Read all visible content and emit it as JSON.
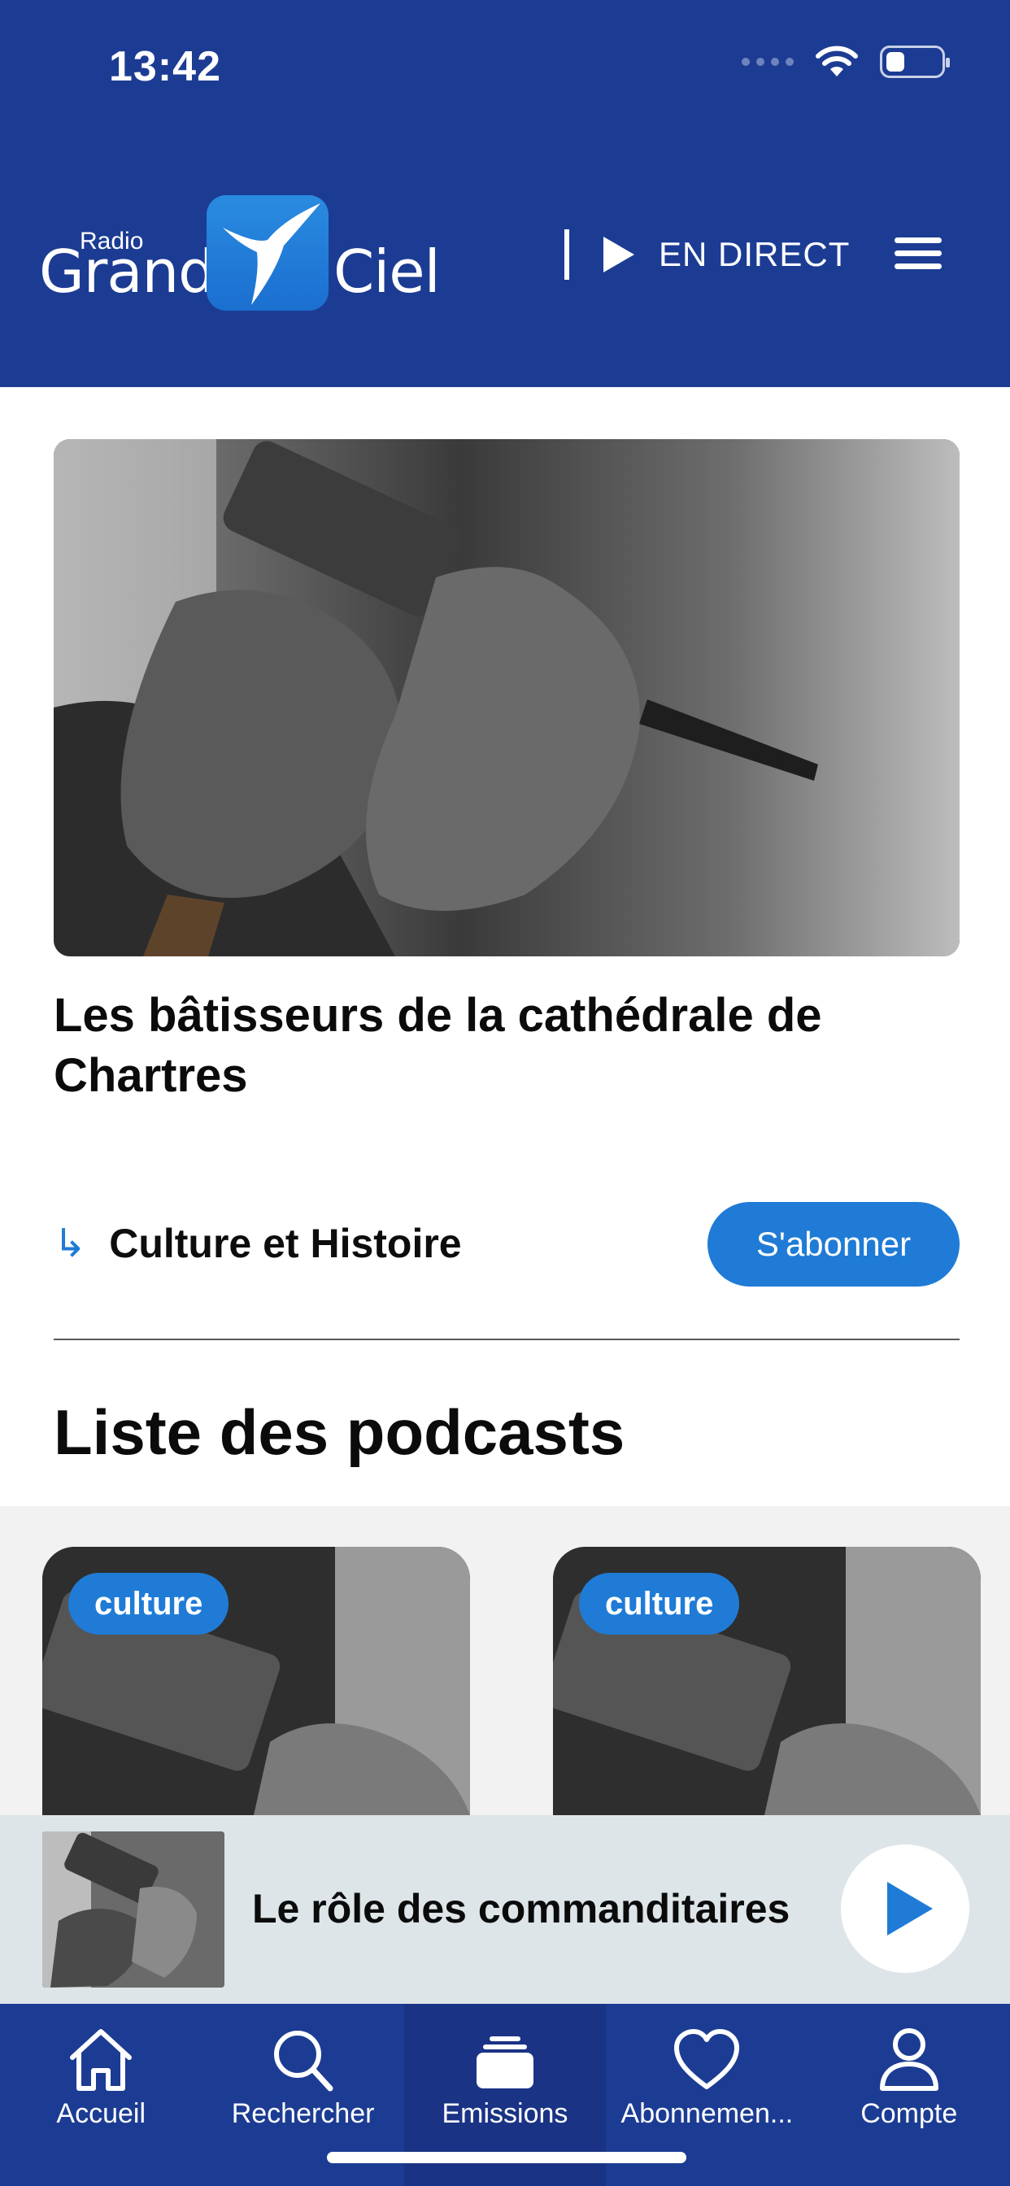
{
  "status_bar": {
    "time": "13:42"
  },
  "header": {
    "logo": {
      "small": "Radio",
      "left": "Grand",
      "right": "Ciel"
    },
    "live_label": "EN DIRECT",
    "menu_icon": "hamburger-icon"
  },
  "hero": {
    "title": "Les bâtisseurs de la cathédrale de Chartres",
    "category_icon": "return-arrow-icon",
    "category": "Culture et Histoire",
    "subscribe_label": "S'abonner"
  },
  "podcasts": {
    "section_title": "Liste des podcasts",
    "cards": [
      {
        "badge": "culture"
      },
      {
        "badge": "culture"
      }
    ]
  },
  "player": {
    "title": "Le rôle des commanditaires",
    "play_icon": "play-icon"
  },
  "tabs": [
    {
      "label": "Accueil",
      "icon": "home-icon"
    },
    {
      "label": "Rechercher",
      "icon": "search-icon"
    },
    {
      "label": "Emissions",
      "icon": "stack-icon",
      "active": true
    },
    {
      "label": "Abonnemen...",
      "icon": "heart-icon"
    },
    {
      "label": "Compte",
      "icon": "user-icon"
    }
  ],
  "colors": {
    "header_bg": "#1c3c93",
    "accent": "#1f7bd6",
    "player_bg": "#dde5e8"
  }
}
